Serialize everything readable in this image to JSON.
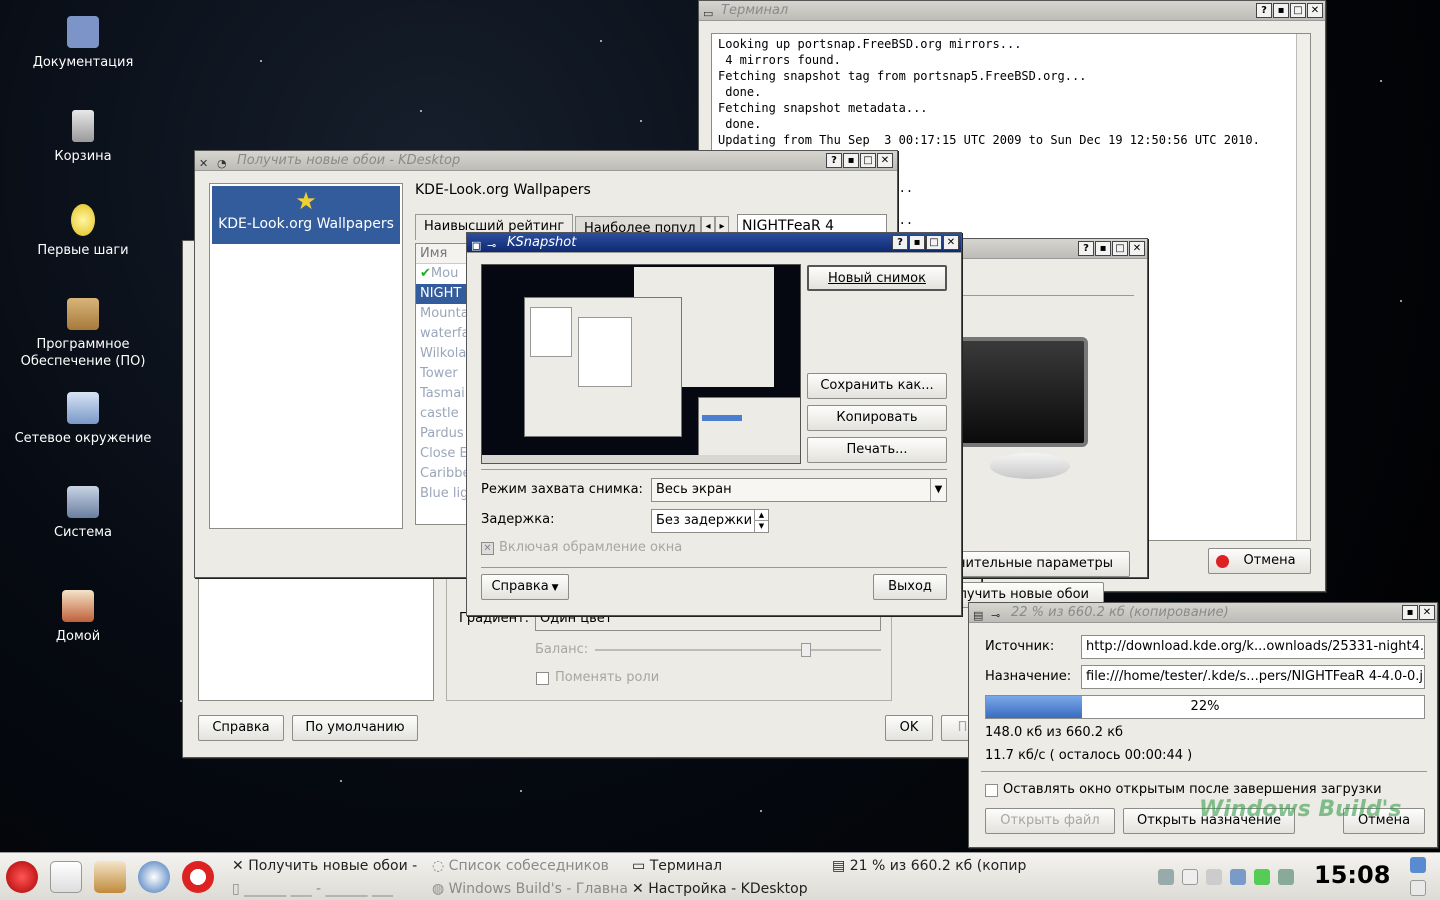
{
  "desktop_icons": [
    {
      "label": "Документация",
      "icon": "book-icon"
    },
    {
      "label": "Корзина",
      "icon": "trash-icon"
    },
    {
      "label": "Первые шаги",
      "icon": "lightbulb-icon"
    },
    {
      "label": "Программное Обеспечение (ПО)",
      "icon": "package-icon"
    },
    {
      "label": "Сетевое окружение",
      "icon": "network-icon"
    },
    {
      "label": "Система",
      "icon": "system-icon"
    },
    {
      "label": "Домой",
      "icon": "home-icon"
    }
  ],
  "terminal": {
    "title": "Терминал",
    "lines": "Looking up portsnap.FreeBSD.org mirrors...\n 4 mirrors found.\nFetching snapshot tag from portsnap5.FreeBSD.org...\n done.\nFetching snapshot metadata...\n done.\nUpdating from Thu Sep  3 00:17:15 UTC 2009 to Sun Dec 19 12:50:56 UTC 2010.\n                      s:\n\n                        ...\n\n                        ..."
  },
  "wallpapers": {
    "title": "Получить новые обои - KDesktop",
    "provider_label": "KDE-Look.org Wallpapers",
    "heading": "KDE-Look.org Wallpapers",
    "tabs": [
      "Наивысший рейтинг",
      "Наиболее попул"
    ],
    "search_value": "NIGHTFeaR 4",
    "column_header": "Имя",
    "items": [
      "Mou",
      "NIGHT",
      "Mounta",
      "waterfa",
      "Wilkola",
      "Tower",
      "Tasmai",
      "castle",
      "Pardus",
      "Close E",
      "Caribbe",
      "Blue lig"
    ]
  },
  "settings_back": {
    "gradient_label": "Градиент:",
    "gradient_value": "Один цвет",
    "balance_label": "Баланс:",
    "swap_label": "Поменять роли",
    "help_button": "Справка",
    "defaults_button": "По умолчанию",
    "ok_button": "OK",
    "apply_button": "П"
  },
  "monitor_dialog": {
    "advanced_button": "нительные параметры",
    "get_wallpapers_button": "олучить новые обои",
    "cancel_button": "Отмена"
  },
  "ksnapshot": {
    "title": "KSnapshot",
    "new_snapshot": "Новый снимок",
    "save_as": "Сохранить как...",
    "copy": "Копировать",
    "print": "Печать...",
    "capture_mode_label": "Режим захвата снимка:",
    "capture_mode_value": "Весь экран",
    "delay_label": "Задержка:",
    "delay_value": "Без задержки",
    "include_decorations": "Включая обрамление окна",
    "help": "Справка",
    "quit": "Выход"
  },
  "download": {
    "title": "22 % из 660.2 кб  (копирование)",
    "source_label": "Источник:",
    "source_value": "http://download.kde.org/k...ownloads/25331-night4.jpg",
    "dest_label": "Назначение:",
    "dest_value": "file:///home/tester/.kde/s...pers/NIGHTFeaR 4-4.0-0.jpg",
    "progress": 22,
    "progress_text": "22%",
    "size_text": "148.0 кб из 660.2 кб",
    "speed_text": "11.7 кб/с ( осталось 00:00:44 )",
    "keep_open": "Оставлять окно открытым после завершения загрузки",
    "open_file": "Открыть файл",
    "open_dest": "Открыть назначение",
    "cancel": "Отмена",
    "watermark": "Windows Build's"
  },
  "taskbar": {
    "tasks_row1": [
      "Получить новые обои -",
      "Список собеседников",
      "Терминал",
      "21 % из 660.2 кб  (копир"
    ],
    "tasks_row2": [
      "______ ___ - ______ ___",
      "Windows Build's - Главная",
      "Настройка - KDesktop"
    ],
    "clock": "15:08"
  },
  "colors": {
    "accent": "#335c9c",
    "title_active": "#1a3a86",
    "progress": "#4a7fd0"
  }
}
